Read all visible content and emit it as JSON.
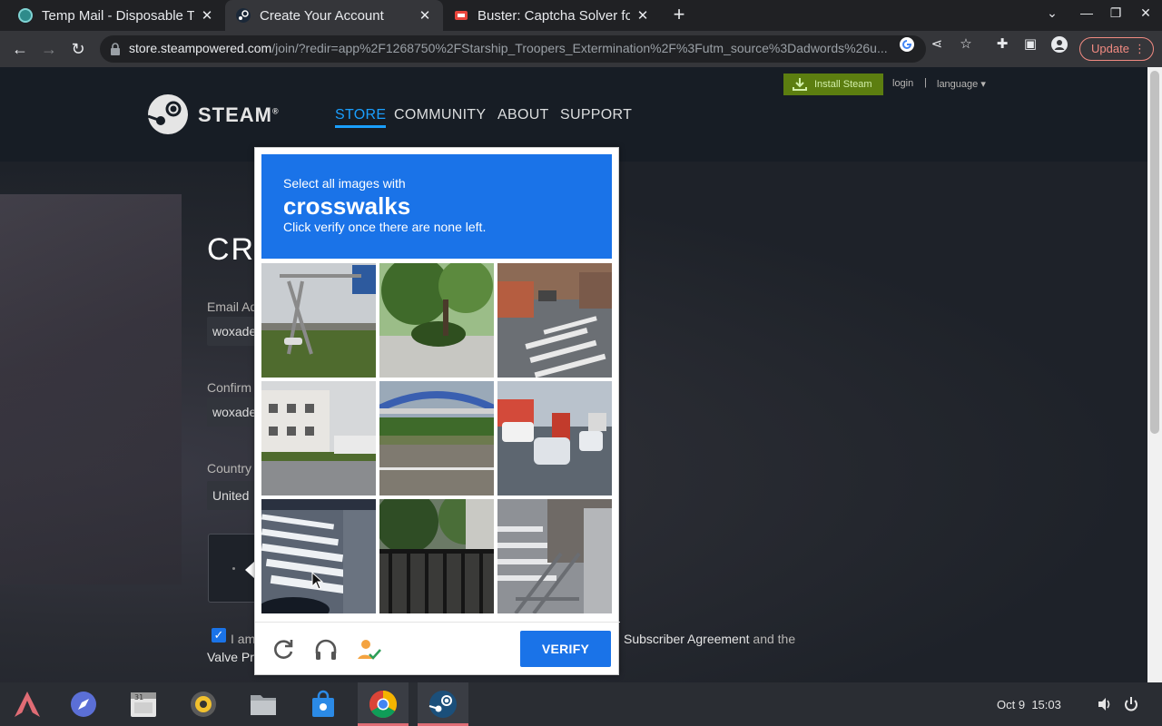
{
  "browser": {
    "tabs": [
      {
        "title": "Temp Mail - Disposable Te",
        "favicon_color": "#2e8b8b"
      },
      {
        "title": "Create Your Account",
        "favicon_color": "#1b2838"
      },
      {
        "title": "Buster: Captcha Solver for",
        "favicon_color": "#e8453c"
      }
    ],
    "url_host": "store.steampowered.com",
    "url_path": "/join/?redir=app%2F1268750%2FStarship_Troopers_Extermination%2F%3Futm_source%3Dadwords%26u...",
    "update_label": "Update",
    "icons": {
      "back": "back-arrow-icon",
      "forward": "forward-arrow-icon",
      "reload": "reload-icon",
      "google": "google-icon",
      "share": "share-icon",
      "bookmark": "star-icon",
      "extensions": "puzzle-icon",
      "sidepanel": "sidepanel-icon",
      "profile": "profile-icon",
      "menu": "kebab-menu-icon"
    }
  },
  "steam": {
    "install_steam": "Install Steam",
    "login": "login",
    "sep": "|",
    "language": "language ▾",
    "logo_text": "STEAM",
    "logo_mark": "®",
    "nav": [
      "STORE",
      "COMMUNITY",
      "ABOUT",
      "SUPPORT"
    ],
    "page_title": "CRE",
    "email_label": "Email Ad",
    "email_value": "woxade",
    "confirm_label": "Confirm",
    "confirm_value": "woxade",
    "country_label": "Country",
    "country_value": "United",
    "agree_prefix": "I am",
    "agree_ssa": "Subscriber Agreement",
    "agree_and": "and the",
    "valve_prefix": "Valve Pr",
    "accent_color": "#1a9fff"
  },
  "recaptcha": {
    "instruction": "Select all images with",
    "target": "crosswalks",
    "subtext": "Click verify once there are none left.",
    "verify_label": "VERIFY",
    "header_color": "#1a73e8",
    "tiles": [
      {
        "name": "tile-highway-sign"
      },
      {
        "name": "tile-tree-sidewalk"
      },
      {
        "name": "tile-street-crosswalk"
      },
      {
        "name": "tile-building-road"
      },
      {
        "name": "tile-bridge-road"
      },
      {
        "name": "tile-traffic-cars"
      },
      {
        "name": "tile-crosswalk-closeup"
      },
      {
        "name": "tile-fence-plants"
      },
      {
        "name": "tile-crosswalk-railing"
      }
    ],
    "footer_icons": [
      "reload-icon",
      "headphones-icon",
      "buster-solver-icon"
    ]
  },
  "taskbar": {
    "apps": [
      "arch-launcher-icon",
      "compass-icon",
      "calendar-icon",
      "media-player-icon",
      "file-manager-icon",
      "store-bag-icon",
      "chrome-icon",
      "steam-icon"
    ],
    "calendar_day": "31",
    "date": "Oct 9",
    "time": "15:03",
    "tray_icons": [
      "volume-icon",
      "power-icon"
    ]
  }
}
